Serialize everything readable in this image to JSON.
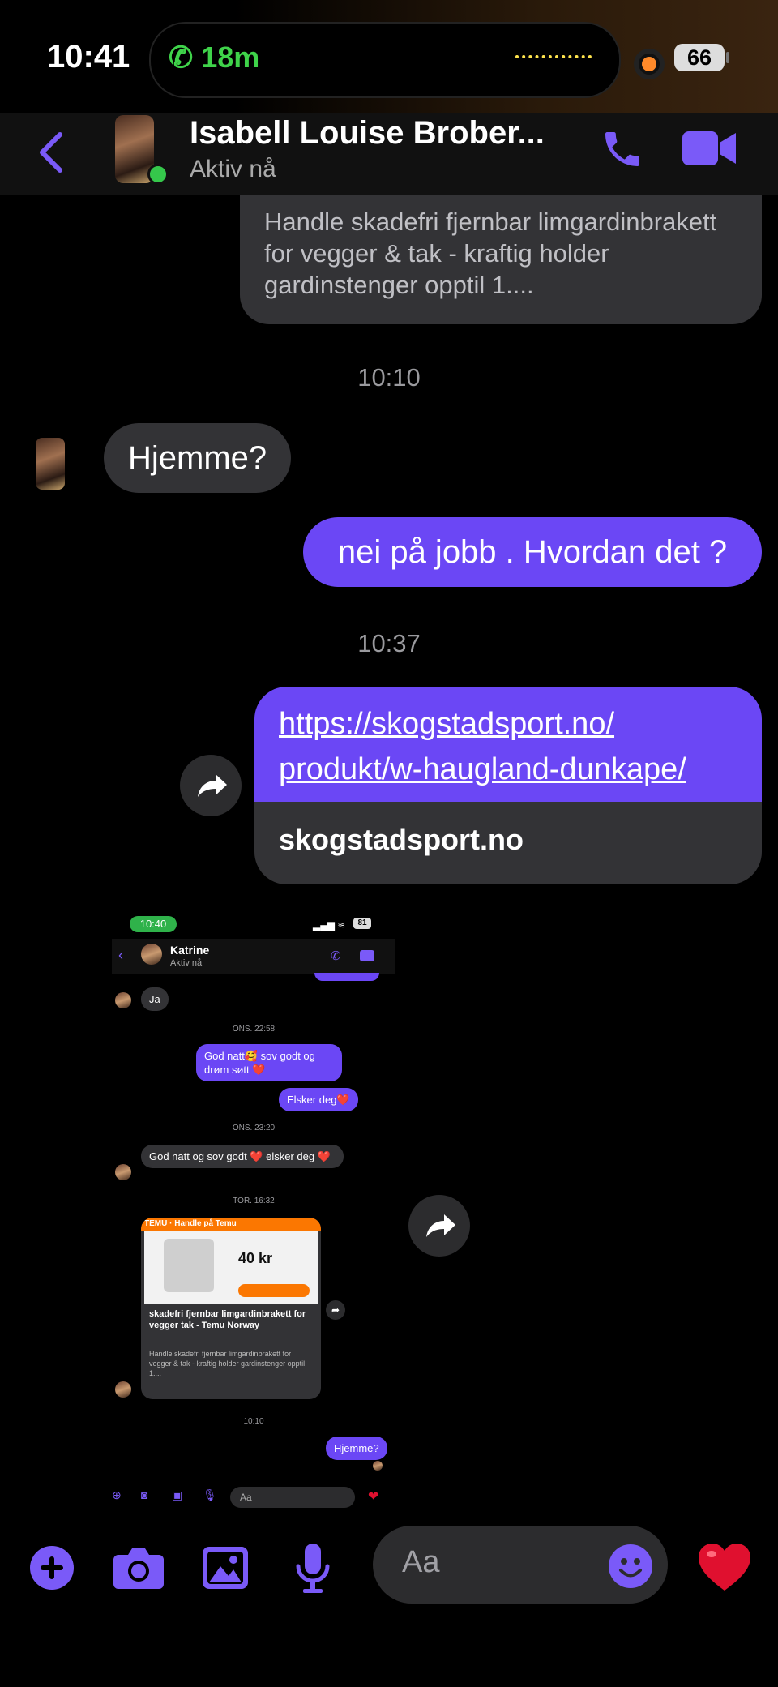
{
  "status_bar": {
    "time": "10:41",
    "call_duration": "18m",
    "battery": "66"
  },
  "header": {
    "contact_name": "Isabell Louise Brober...",
    "contact_status": "Aktiv nå"
  },
  "messages": {
    "link_preview_desc": "Handle skadefri fjernbar limgardinbrakett   for vegger & tak - kraftig holder gardinstenger opptil 1....",
    "ts1": "10:10",
    "hjemme": "Hjemme?",
    "nei": "nei på jobb . Hvordan det ?",
    "ts2": "10:37",
    "url": "https://skogstadsport.no/produkt/w-haugland-dunkape/",
    "url_line1": "https://skogstadsport.no/",
    "url_line2": "produkt/w-haugland-dunkape/",
    "url_domain": "skogstadsport.no"
  },
  "embedded_screenshot": {
    "time": "10:40",
    "battery": "81",
    "name": "Katrine",
    "status": "Aktiv nå",
    "ja": "Ja",
    "ts1": "ONS. 22:58",
    "godnatt": "God natt🥰 sov godt og drøm søtt ❤️",
    "elsker": "Elsker deg❤️",
    "ts2": "ONS. 23:20",
    "godnatt2": "God natt og sov godt ❤️ elsker deg ❤️",
    "ts3": "TOR. 16:32",
    "temu_brand": "TEMU · Handle på Temu",
    "temu_price": "40 kr",
    "temu_title": "skadefri fjernbar limgardinbrakett   for vegger tak - Temu Norway",
    "temu_desc": "Handle skadefri fjernbar limgardinbrakett   for vegger & tak - kraftig holder gardinstenger opptil 1....",
    "ts4": "10:10",
    "hjemme": "Hjemme?",
    "composer": "Aa"
  },
  "composer": {
    "placeholder": "Aa"
  },
  "colors": {
    "accent": "#7a5af8",
    "bubble_out": "#6b47f5",
    "bubble_in": "#333336",
    "online": "#35c74b"
  }
}
